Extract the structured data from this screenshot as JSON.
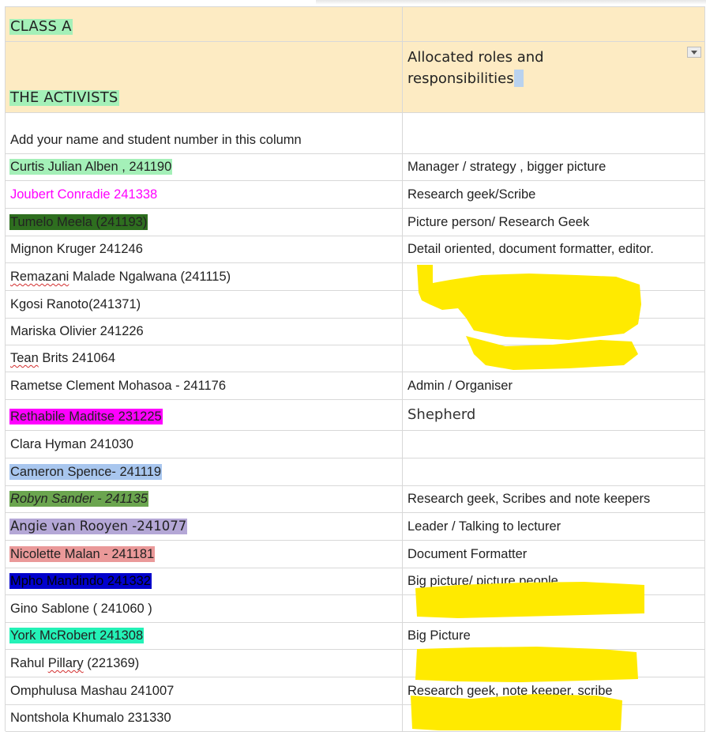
{
  "header": {
    "class_label": "CLASS A",
    "group_name": "THE ACTIVISTS",
    "roles_heading": "Allocated roles and responsibilities"
  },
  "instruction": "Add your name and student number in this column",
  "rows": [
    {
      "name": "Curtis Julian Alben , 241190",
      "role": "Manager / strategy , bigger picture",
      "highlight": "#a4f0b8",
      "color": "#222222"
    },
    {
      "name": "Joubert Conradie 241338",
      "role": "Research geek/Scribe",
      "highlight": "",
      "color": "#ff00ff"
    },
    {
      "name": "Tumelo Meela (241193)",
      "role": "Picture person/ Research Geek",
      "highlight": "#2e6e1f",
      "color": "#222222"
    },
    {
      "name": "Mignon Kruger 241246",
      "role": "Detail oriented, document formatter, editor.",
      "highlight": "",
      "color": "#222222"
    },
    {
      "name": "Remazani Malade Ngalwana (241115)",
      "role": "",
      "highlight": "",
      "color": "#222222"
    },
    {
      "name": "Kgosi Ranoto(241371)",
      "role": "",
      "highlight": "",
      "color": "#222222"
    },
    {
      "name": "Mariska Olivier 241226",
      "role": "",
      "highlight": "",
      "color": "#222222"
    },
    {
      "name": "Tean Brits 241064",
      "role": "",
      "highlight": "",
      "color": "#222222"
    },
    {
      "name": "Rametse Clement Mohasoa - 241176",
      "role": "Admin / Organiser",
      "highlight": "",
      "color": "#222222"
    },
    {
      "name": "Rethabile Maditse 231225",
      "role": "Shepherd",
      "highlight": "#ff00ff",
      "color": "#222222"
    },
    {
      "name": "Clara Hyman 241030",
      "role": "",
      "highlight": "",
      "color": "#222222"
    },
    {
      "name": "Cameron Spence- 241119",
      "role": "",
      "highlight": "#a8c6ee",
      "color": "#222222"
    },
    {
      "name": "Robyn Sander - 241135",
      "role": "Research geek, Scribes and note keepers",
      "highlight": "#6ba54f",
      "color": "#222222"
    },
    {
      "name": "Angie van Rooyen -241077",
      "role": "Leader / Talking to lecturer",
      "highlight": "#b4a7d6",
      "color": "#222222"
    },
    {
      "name": "Nicolette Malan - 241181",
      "role": "Document Formatter",
      "highlight": "#ea9999",
      "color": "#222222"
    },
    {
      "name": "Mpho Mandindo 241332",
      "role": "Big picture/ picture people",
      "highlight": "#0000cc",
      "color": "#000000"
    },
    {
      "name": "Gino Sablone ( 241060 )",
      "role": "",
      "highlight": "",
      "color": "#222222"
    },
    {
      "name": "York McRobert 241308",
      "role": "Big Picture",
      "highlight": "#24f2b7",
      "color": "#222222"
    },
    {
      "name": "Rahul Pillary (221369)",
      "role": "",
      "highlight": "",
      "color": "#222222"
    },
    {
      "name": "Omphulusa Mashau 241007",
      "role": "Research geek, note keeper, scribe",
      "highlight": "",
      "color": "#222222"
    },
    {
      "name": "Nontshola Khumalo 231330",
      "role": "",
      "highlight": "",
      "color": "#222222"
    }
  ],
  "colors": {
    "header_bg": "#fdebc3",
    "header_text_highlight": "#a4f0b8",
    "redaction_scribble": "#ffea00",
    "grid_line": "#d8d8d8"
  },
  "icons": {
    "filter_dropdown": "dropdown-arrow-icon"
  }
}
